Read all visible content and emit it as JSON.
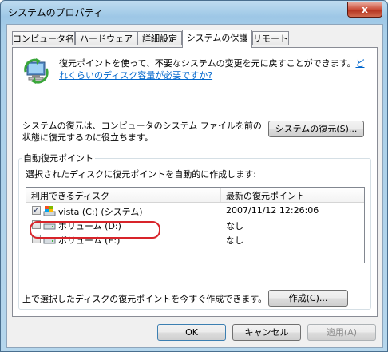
{
  "window": {
    "title": "システムのプロパティ",
    "close_label": "x"
  },
  "tabs": [
    {
      "label": "コンピュータ名",
      "active": false
    },
    {
      "label": "ハードウェア",
      "active": false
    },
    {
      "label": "詳細設定",
      "active": false
    },
    {
      "label": "システムの保護",
      "active": true
    },
    {
      "label": "リモート",
      "active": false
    }
  ],
  "intro": {
    "text": "復元ポイントを使って、不要なシステムの変更を元に戻すことができます。",
    "link": "どれくらいのディスク容量が必要ですか?"
  },
  "restore": {
    "description": "システムの復元は、コンピュータのシステム ファイルを前の状態に復元するのに役立ちます。",
    "button": "システムの復元(S)..."
  },
  "auto_restore": {
    "legend": "自動復元ポイント",
    "description": "選択されたディスクに復元ポイントを自動的に作成します:",
    "columns": [
      "利用できるディスク",
      "最新の復元ポイント"
    ],
    "disks": [
      {
        "name": "vista (C:) (システム)",
        "latest": "2007/11/12 12:26:06",
        "checked": true
      },
      {
        "name": "ボリューム (D:)",
        "latest": "なし",
        "checked": false
      },
      {
        "name": "ボリューム (E:)",
        "latest": "なし",
        "checked": false
      }
    ],
    "create_text": "上で選択したディスクの復元ポイントを今すぐ作成できます。",
    "create_button": "作成(C)..."
  },
  "footer": {
    "ok": "OK",
    "cancel": "キャンセル",
    "apply": "適用(A)"
  },
  "colors": {
    "link": "#0066cc",
    "highlight": "#d8242a",
    "close": "#c94a35"
  }
}
